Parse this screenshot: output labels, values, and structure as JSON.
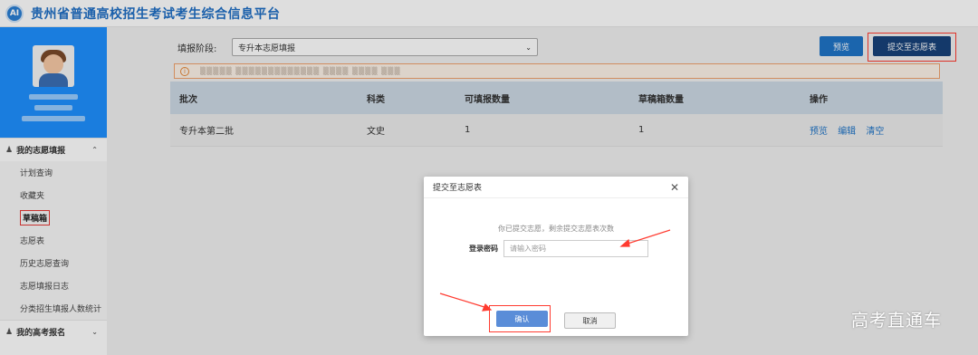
{
  "header": {
    "logo_text": "AI",
    "title": "贵州省普通高校招生考试考生综合信息平台"
  },
  "sidebar": {
    "group1": {
      "label": "我的志愿填报",
      "expanded_icon": "chevron-up-icon"
    },
    "items": [
      {
        "label": "计划查询"
      },
      {
        "label": "收藏夹"
      },
      {
        "label": "草稿箱",
        "active": true
      },
      {
        "label": "志愿表"
      },
      {
        "label": "历史志愿查询"
      },
      {
        "label": "志愿填报日志"
      },
      {
        "label": "分类招生填报人数统计"
      }
    ],
    "group2": {
      "label": "我的高考报名",
      "collapsed_icon": "chevron-down-icon"
    }
  },
  "main": {
    "stage_label": "填报阶段:",
    "stage_value": "专升本志愿填报",
    "preview_button": "预览",
    "submit_button": "提交至志愿表",
    "table": {
      "headers": [
        "批次",
        "科类",
        "可填报数量",
        "草稿箱数量",
        "操作"
      ],
      "rows": [
        {
          "batch": "专升本第二批",
          "category": "文史",
          "available": "1",
          "drafts": "1",
          "actions": [
            "预览",
            "编辑",
            "清空"
          ]
        }
      ]
    }
  },
  "dialog": {
    "title": "提交至志愿表",
    "close_icon": "close-icon",
    "message": "你已提交志愿，剩余提交志愿表次数",
    "password_label": "登录密码",
    "password_placeholder": "请输入密码",
    "confirm_button": "确认",
    "cancel_button": "取消"
  },
  "watermark": "高考直通车",
  "colors": {
    "brand": "#1f74c7",
    "submit": "#17427a",
    "highlight": "#ff3b30",
    "sidebar_profile": "#1e90ff"
  }
}
